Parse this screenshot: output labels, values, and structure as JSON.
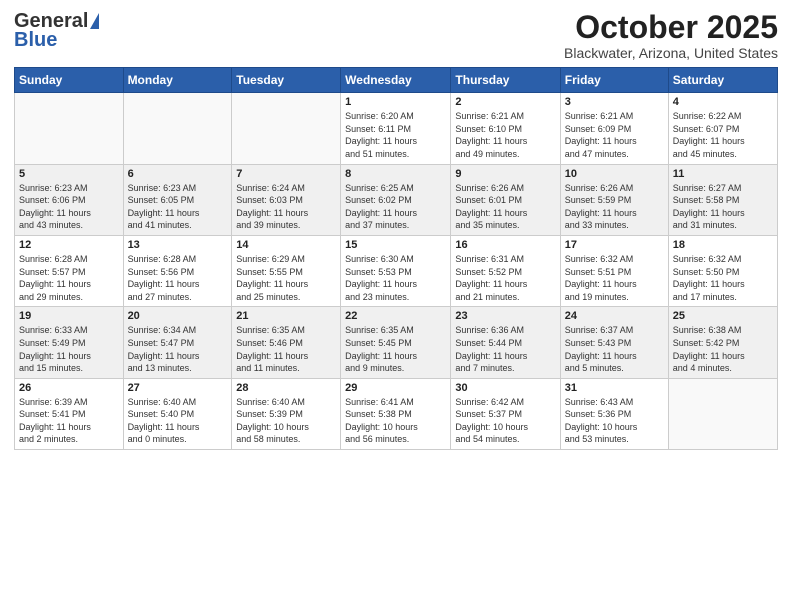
{
  "header": {
    "logo_general": "General",
    "logo_blue": "Blue",
    "month": "October 2025",
    "location": "Blackwater, Arizona, United States"
  },
  "weekdays": [
    "Sunday",
    "Monday",
    "Tuesday",
    "Wednesday",
    "Thursday",
    "Friday",
    "Saturday"
  ],
  "weeks": [
    [
      {
        "day": "",
        "info": ""
      },
      {
        "day": "",
        "info": ""
      },
      {
        "day": "",
        "info": ""
      },
      {
        "day": "1",
        "info": "Sunrise: 6:20 AM\nSunset: 6:11 PM\nDaylight: 11 hours\nand 51 minutes."
      },
      {
        "day": "2",
        "info": "Sunrise: 6:21 AM\nSunset: 6:10 PM\nDaylight: 11 hours\nand 49 minutes."
      },
      {
        "day": "3",
        "info": "Sunrise: 6:21 AM\nSunset: 6:09 PM\nDaylight: 11 hours\nand 47 minutes."
      },
      {
        "day": "4",
        "info": "Sunrise: 6:22 AM\nSunset: 6:07 PM\nDaylight: 11 hours\nand 45 minutes."
      }
    ],
    [
      {
        "day": "5",
        "info": "Sunrise: 6:23 AM\nSunset: 6:06 PM\nDaylight: 11 hours\nand 43 minutes."
      },
      {
        "day": "6",
        "info": "Sunrise: 6:23 AM\nSunset: 6:05 PM\nDaylight: 11 hours\nand 41 minutes."
      },
      {
        "day": "7",
        "info": "Sunrise: 6:24 AM\nSunset: 6:03 PM\nDaylight: 11 hours\nand 39 minutes."
      },
      {
        "day": "8",
        "info": "Sunrise: 6:25 AM\nSunset: 6:02 PM\nDaylight: 11 hours\nand 37 minutes."
      },
      {
        "day": "9",
        "info": "Sunrise: 6:26 AM\nSunset: 6:01 PM\nDaylight: 11 hours\nand 35 minutes."
      },
      {
        "day": "10",
        "info": "Sunrise: 6:26 AM\nSunset: 5:59 PM\nDaylight: 11 hours\nand 33 minutes."
      },
      {
        "day": "11",
        "info": "Sunrise: 6:27 AM\nSunset: 5:58 PM\nDaylight: 11 hours\nand 31 minutes."
      }
    ],
    [
      {
        "day": "12",
        "info": "Sunrise: 6:28 AM\nSunset: 5:57 PM\nDaylight: 11 hours\nand 29 minutes."
      },
      {
        "day": "13",
        "info": "Sunrise: 6:28 AM\nSunset: 5:56 PM\nDaylight: 11 hours\nand 27 minutes."
      },
      {
        "day": "14",
        "info": "Sunrise: 6:29 AM\nSunset: 5:55 PM\nDaylight: 11 hours\nand 25 minutes."
      },
      {
        "day": "15",
        "info": "Sunrise: 6:30 AM\nSunset: 5:53 PM\nDaylight: 11 hours\nand 23 minutes."
      },
      {
        "day": "16",
        "info": "Sunrise: 6:31 AM\nSunset: 5:52 PM\nDaylight: 11 hours\nand 21 minutes."
      },
      {
        "day": "17",
        "info": "Sunrise: 6:32 AM\nSunset: 5:51 PM\nDaylight: 11 hours\nand 19 minutes."
      },
      {
        "day": "18",
        "info": "Sunrise: 6:32 AM\nSunset: 5:50 PM\nDaylight: 11 hours\nand 17 minutes."
      }
    ],
    [
      {
        "day": "19",
        "info": "Sunrise: 6:33 AM\nSunset: 5:49 PM\nDaylight: 11 hours\nand 15 minutes."
      },
      {
        "day": "20",
        "info": "Sunrise: 6:34 AM\nSunset: 5:47 PM\nDaylight: 11 hours\nand 13 minutes."
      },
      {
        "day": "21",
        "info": "Sunrise: 6:35 AM\nSunset: 5:46 PM\nDaylight: 11 hours\nand 11 minutes."
      },
      {
        "day": "22",
        "info": "Sunrise: 6:35 AM\nSunset: 5:45 PM\nDaylight: 11 hours\nand 9 minutes."
      },
      {
        "day": "23",
        "info": "Sunrise: 6:36 AM\nSunset: 5:44 PM\nDaylight: 11 hours\nand 7 minutes."
      },
      {
        "day": "24",
        "info": "Sunrise: 6:37 AM\nSunset: 5:43 PM\nDaylight: 11 hours\nand 5 minutes."
      },
      {
        "day": "25",
        "info": "Sunrise: 6:38 AM\nSunset: 5:42 PM\nDaylight: 11 hours\nand 4 minutes."
      }
    ],
    [
      {
        "day": "26",
        "info": "Sunrise: 6:39 AM\nSunset: 5:41 PM\nDaylight: 11 hours\nand 2 minutes."
      },
      {
        "day": "27",
        "info": "Sunrise: 6:40 AM\nSunset: 5:40 PM\nDaylight: 11 hours\nand 0 minutes."
      },
      {
        "day": "28",
        "info": "Sunrise: 6:40 AM\nSunset: 5:39 PM\nDaylight: 10 hours\nand 58 minutes."
      },
      {
        "day": "29",
        "info": "Sunrise: 6:41 AM\nSunset: 5:38 PM\nDaylight: 10 hours\nand 56 minutes."
      },
      {
        "day": "30",
        "info": "Sunrise: 6:42 AM\nSunset: 5:37 PM\nDaylight: 10 hours\nand 54 minutes."
      },
      {
        "day": "31",
        "info": "Sunrise: 6:43 AM\nSunset: 5:36 PM\nDaylight: 10 hours\nand 53 minutes."
      },
      {
        "day": "",
        "info": ""
      }
    ]
  ]
}
